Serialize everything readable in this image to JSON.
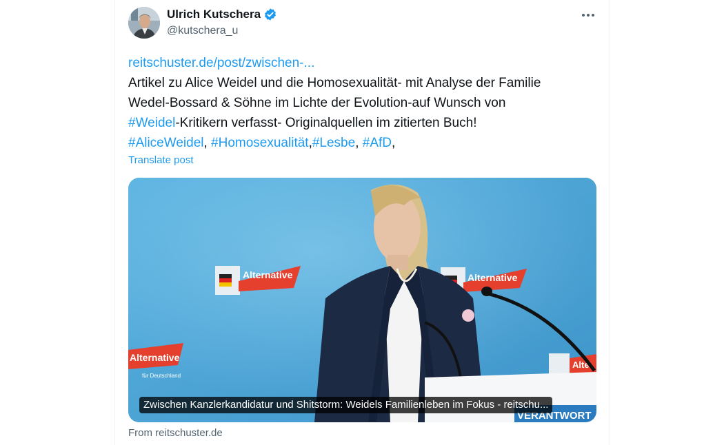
{
  "author": {
    "display_name": "Ulrich Kutschera",
    "handle": "@kutschera_u",
    "verified": true
  },
  "post": {
    "link_text": "reitschuster.de/post/zwischen-...",
    "line1": " Artikel zu Alice Weidel und die Homosexualität- mit Analyse der Familie",
    "line2": "Wedel-Bossard & Söhne im Lichte der Evolution-auf Wunsch von",
    "hashtag_weidel": "#Weidel",
    "line3_rest": "-Kritikern verfasst- Originalquellen im zitierten Buch!",
    "hashtags": [
      "#AliceWeidel",
      "#Homosexualität",
      "#Lesbe",
      "#AfD"
    ],
    "sep_comma_space": ", ",
    "sep_comma": ",",
    "trailing": ",",
    "translate_label": "Translate post"
  },
  "card": {
    "caption": "Zwischen Kanzlerkandidatur und Shitstorm: Weidels Familienleben im Fokus - reitschu...",
    "source": "From reitschuster.de",
    "backdrop_texts": [
      "Alternative",
      "Alternative",
      "Alternative",
      "Alte"
    ],
    "backdrop_sub": "für Deutschland",
    "podium_text": "VERANTWORT"
  },
  "colors": {
    "link": "#1d9bf0",
    "text": "#0f1419",
    "secondary": "#536471",
    "verified": "#1d9bf0"
  }
}
